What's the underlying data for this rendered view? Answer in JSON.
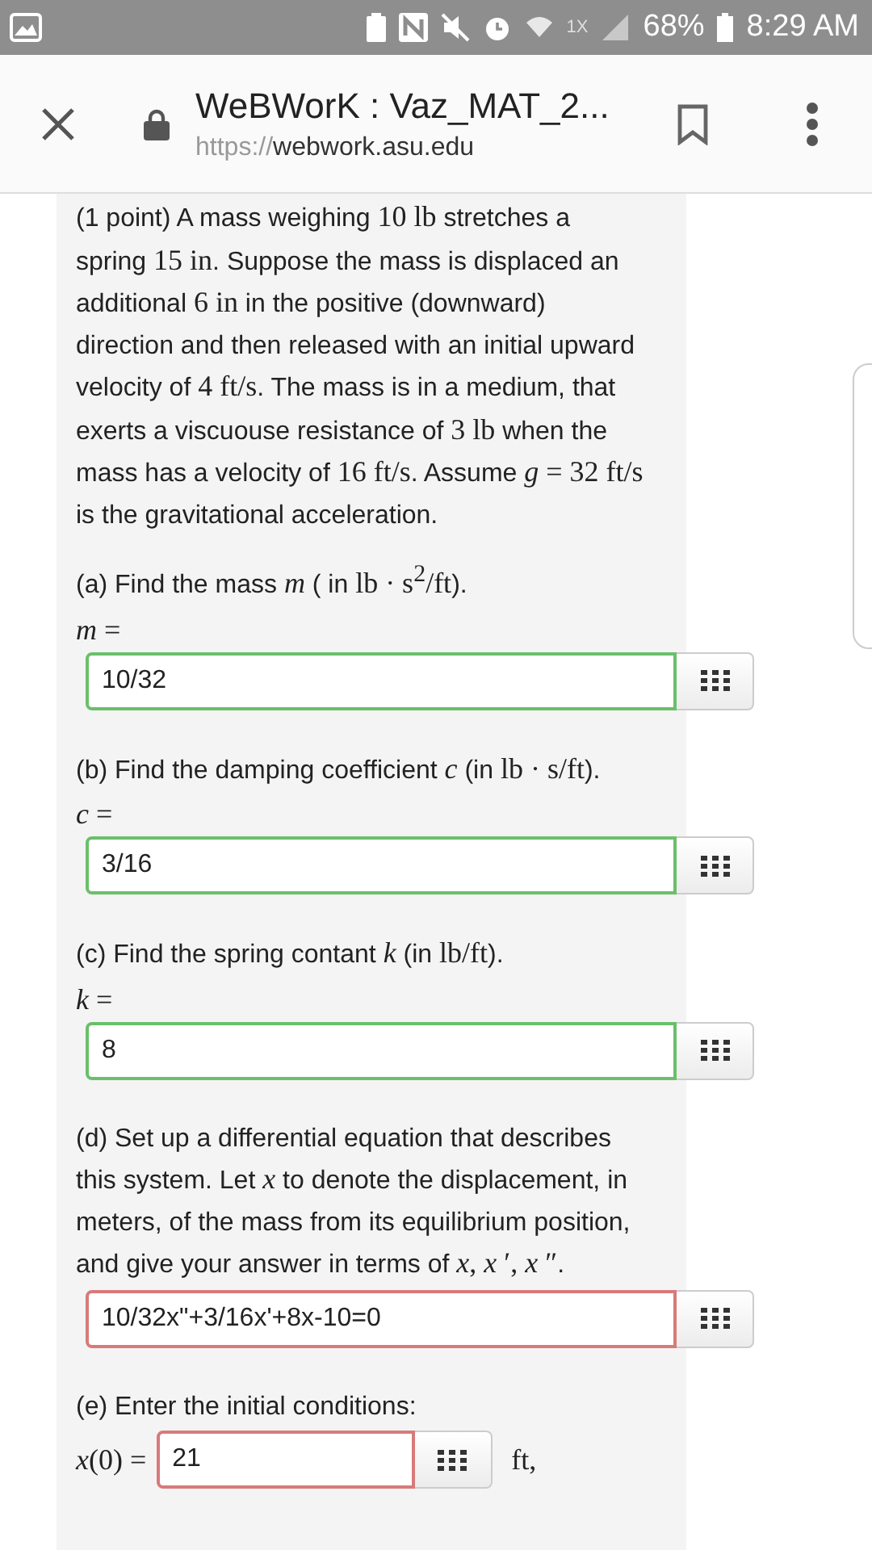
{
  "status_bar": {
    "network_label": "1X",
    "battery": "68%",
    "time": "8:29 AM"
  },
  "browser": {
    "title": "WeBWorK : Vaz_MAT_2...",
    "url_scheme": "https://",
    "url_host": "webwork.asu.edu"
  },
  "problem": {
    "intro": [
      {
        "kind": "text",
        "text": "(1 point) A mass weighing "
      },
      {
        "kind": "math",
        "text": "10 lb"
      },
      {
        "kind": "text",
        "text": " stretches a spring "
      },
      {
        "kind": "math",
        "text": "15 in"
      },
      {
        "kind": "text",
        "text": ". Suppose the mass is displaced an additional "
      },
      {
        "kind": "math",
        "text": "6 in"
      },
      {
        "kind": "text",
        "text": " in the positive (downward) direction and then released with an initial upward velocity of "
      },
      {
        "kind": "math",
        "text": "4 ft/s"
      },
      {
        "kind": "text",
        "text": ". The mass is in a medium, that exerts a viscuouse resistance of "
      },
      {
        "kind": "math",
        "text": "3 lb"
      },
      {
        "kind": "text",
        "text": " when the mass has a velocity of "
      },
      {
        "kind": "math",
        "text": "16 ft/s"
      },
      {
        "kind": "text",
        "text": ". Assume "
      },
      {
        "kind": "math",
        "text": "*g* = 32 ft/s"
      },
      {
        "kind": "text",
        "text": " is the gravitational acceleration."
      }
    ],
    "parts": [
      {
        "prompt": [
          {
            "kind": "text",
            "text": "(a) Find the mass "
          },
          {
            "kind": "math",
            "text": "*m*"
          },
          {
            "kind": "text",
            "text": " ( in "
          },
          {
            "kind": "math",
            "text": "lb · s$^{2}$/ft"
          },
          {
            "kind": "text",
            "text": ")."
          }
        ],
        "answer": {
          "kind": "below",
          "label": "*m* =",
          "value": "10/32",
          "correct": true
        }
      },
      {
        "prompt": [
          {
            "kind": "text",
            "text": "(b) Find the damping coefficient "
          },
          {
            "kind": "math",
            "text": "*c*"
          },
          {
            "kind": "text",
            "text": " (in "
          },
          {
            "kind": "math",
            "text": "lb · s/ft"
          },
          {
            "kind": "text",
            "text": ")."
          }
        ],
        "answer": {
          "kind": "below",
          "label": "*c* =",
          "value": "3/16",
          "correct": true
        }
      },
      {
        "prompt": [
          {
            "kind": "text",
            "text": "(c) Find the spring contant "
          },
          {
            "kind": "math",
            "text": "*k*"
          },
          {
            "kind": "text",
            "text": " (in "
          },
          {
            "kind": "math",
            "text": "lb/ft"
          },
          {
            "kind": "text",
            "text": ")."
          }
        ],
        "answer": {
          "kind": "below",
          "label": "*k* =",
          "value": "8",
          "correct": true
        }
      },
      {
        "prompt": [
          {
            "kind": "text",
            "text": "(d) Set up a differential equation that describes this system. Let "
          },
          {
            "kind": "math",
            "text": "*x*"
          },
          {
            "kind": "text",
            "text": " to denote the displacement, in meters, of the mass from its equilibrium position, and give your answer in terms of "
          },
          {
            "kind": "math",
            "text": "*x*, *x* ′, *x* ″"
          },
          {
            "kind": "text",
            "text": "."
          }
        ],
        "answer": {
          "kind": "none",
          "value": "10/32x\"+3/16x'+8x-10=0",
          "correct": false
        }
      },
      {
        "prompt": [
          {
            "kind": "text",
            "text": "(e) Enter the initial conditions:"
          }
        ],
        "answer": {
          "kind": "inline",
          "label": "*x*(0) =",
          "value": "21",
          "correct": false,
          "unit": "ft,"
        }
      }
    ]
  }
}
